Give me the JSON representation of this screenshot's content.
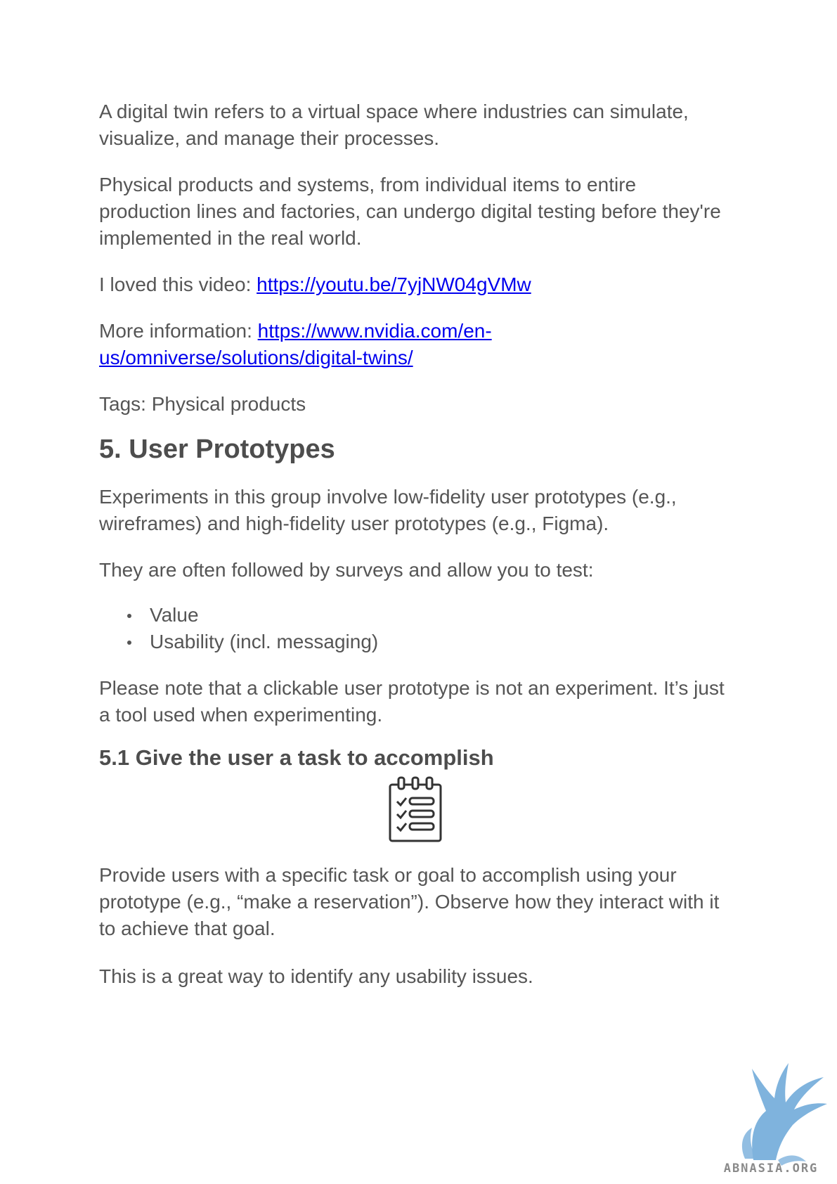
{
  "paragraphs": {
    "intro": "A digital twin refers to a virtual space where industries can simulate, visualize, and manage their processes.",
    "physical": "Physical products and systems, from individual items to entire production lines and factories, can undergo digital testing before they're implemented in the real world.",
    "video_label": "I loved this video: ",
    "video_link": "https://youtu.be/7yjNW04gVMw",
    "info_label": "More information: ",
    "info_link": "https://www.nvidia.com/en-us/omniverse/solutions/digital-twins/",
    "tags": "Tags: Physical products"
  },
  "section5": {
    "heading": "5. User Prototypes",
    "p1": "Experiments in this group involve low-fidelity user prototypes (e.g., wireframes) and high-fidelity user prototypes (e.g., Figma).",
    "p2": "They are often followed by surveys and allow you to test:",
    "bullets": [
      "Value",
      "Usability (incl. messaging)"
    ],
    "p3": "Please note that a clickable user prototype is not an experiment. It’s just a tool used when experimenting."
  },
  "section51": {
    "heading": "5.1 Give the user a task to accomplish",
    "icon": "checklist-icon",
    "p1": "Provide users with a specific task or goal to accomplish using your prototype (e.g., “make a reservation”). Observe how they interact with it to achieve that goal.",
    "p2": "This is a great way to identify any usability issues."
  },
  "footer": {
    "logo_icon": "griffin-logo-icon",
    "logo_text": "ABNASIA.ORG",
    "logo_color": "#7fb3dd"
  },
  "colors": {
    "text": "#555555",
    "link": "#0000ee",
    "heading": "#4d4d4d"
  }
}
